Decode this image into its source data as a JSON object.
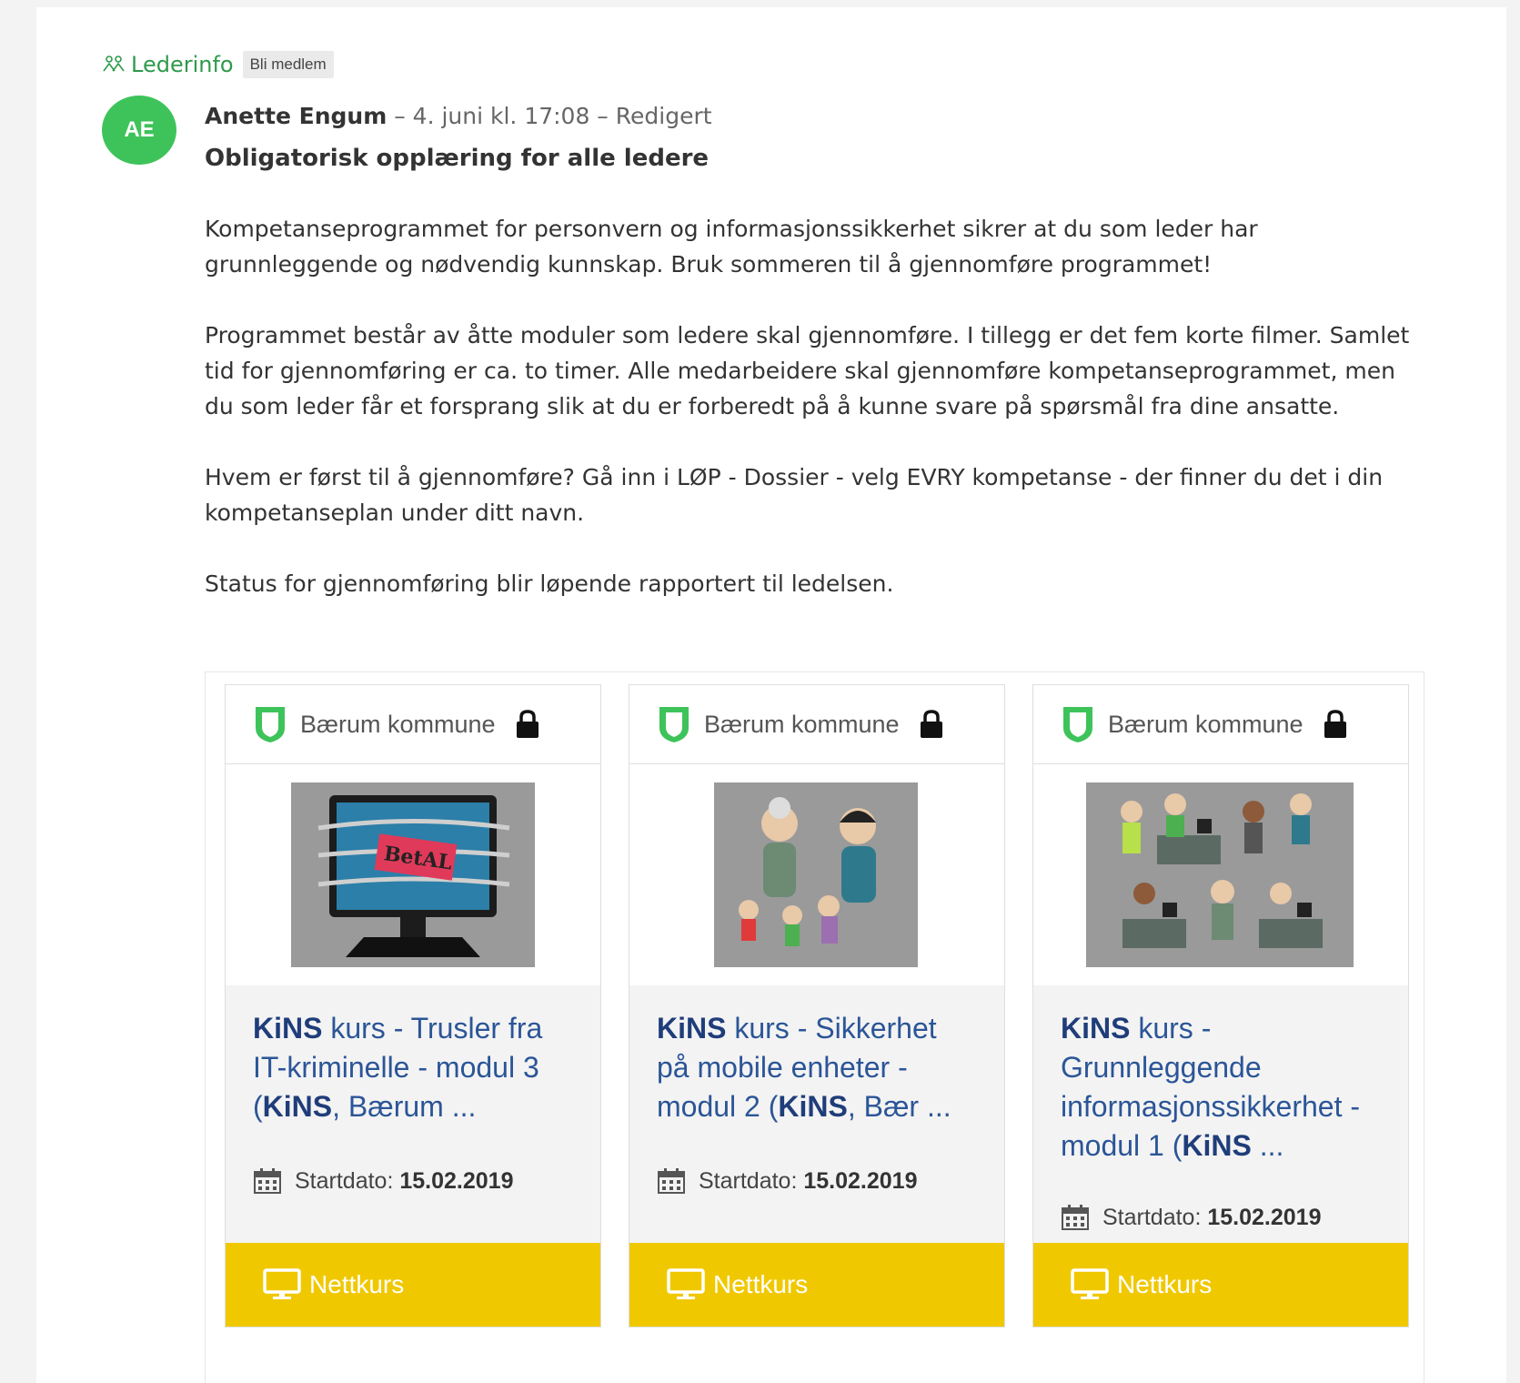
{
  "group": {
    "name": "Lederinfo",
    "join_label": "Bli medlem",
    "icon": "group-icon"
  },
  "post": {
    "avatar_initials": "AE",
    "author": "Anette Engum",
    "meta_suffix": " – 4. juni kl. 17:08 – Redigert",
    "title": "Obligatorisk opplæring for alle ledere",
    "paragraphs": [
      "Kompetanseprogrammet for personvern og informasjonssikkerhet sikrer at du som leder har grunnleggende og nødvendig kunnskap. Bruk sommeren til å gjennomføre programmet!",
      "Programmet består av åtte moduler som ledere skal gjennomføre. I tillegg er det fem korte filmer. Samlet tid for gjennomføring er ca. to timer. Alle medarbeidere skal gjennomføre kompetanseprogrammet, men du som leder får et forsprang slik at du er forberedt på å kunne svare på spørsmål fra dine ansatte.",
      "Hvem er først til å gjennomføre? Gå inn i LØP - Dossier - velg EVRY kompetanse - der finner du det i din kompetanseplan under ditt navn.",
      "Status for gjennomføring blir løpende rapportert til ledelsen."
    ]
  },
  "cards": [
    {
      "org": "Bærum kommune",
      "image": "ransomware-monitor-image",
      "image_text": "BetAL",
      "title_html": "<b>KiNS</b> kurs - Trusler fra IT-kriminelle - modul 3 (<b>KiNS</b>, Bærum ...",
      "date_label": "Startdato: ",
      "date_value": "15.02.2019",
      "foot_label": "Nettkurs"
    },
    {
      "org": "Bærum kommune",
      "image": "family-mobile-image",
      "title_html": "<b>KiNS</b> kurs - Sikkerhet på mobile enheter - modul 2 (<b>KiNS</b>, Bær ...",
      "date_label": "Startdato: ",
      "date_value": "15.02.2019",
      "foot_label": "Nettkurs"
    },
    {
      "org": "Bærum kommune",
      "image": "office-workers-image",
      "title_html": "<b>KiNS</b> kurs - Grunnleggende informasjonssikkerhet - modul 1 (<b>KiNS</b> ...",
      "date_label": "Startdato: ",
      "date_value": "15.02.2019",
      "foot_label": "Nettkurs"
    }
  ],
  "colors": {
    "green": "#2e9a4b",
    "avatar": "#3ec35a",
    "course_blue": "#2b5597",
    "footer_yellow": "#f0c800"
  }
}
